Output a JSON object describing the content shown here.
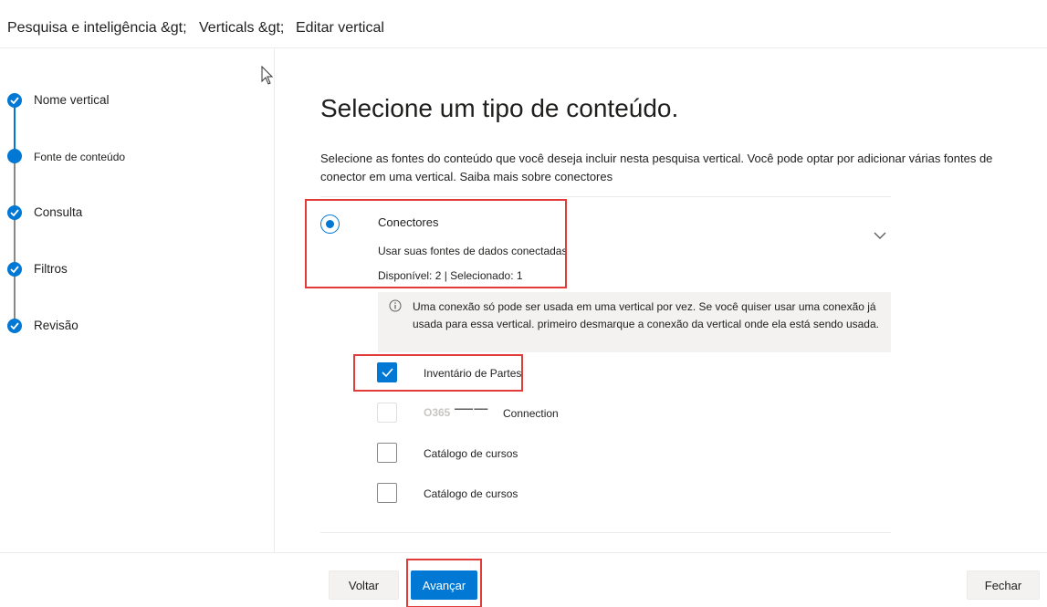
{
  "breadcrumb": {
    "items": [
      "Pesquisa e inteligência &gt;",
      "Verticals &gt;",
      "Editar vertical"
    ]
  },
  "steps": [
    {
      "label": "Nome vertical",
      "state": "completed"
    },
    {
      "label": "Fonte de conteúdo",
      "state": "current"
    },
    {
      "label": "Consulta",
      "state": "completed"
    },
    {
      "label": "Filtros",
      "state": "completed"
    },
    {
      "label": "Revisão",
      "state": "completed"
    }
  ],
  "main": {
    "title": "Selecione um tipo de conteúdo.",
    "description": "Selecione as fontes do conteúdo que você deseja incluir nesta pesquisa vertical. Você pode optar por adicionar várias fontes de conector em uma vertical.",
    "learn_more": "Saiba mais sobre conectores"
  },
  "connectors": {
    "title": "Conectores",
    "subtitle": "Usar suas fontes de dados conectadas",
    "stats": "Disponível: 2 | Selecionado: 1",
    "selected": true,
    "expanded": true,
    "info": "Uma conexão só pode ser usada em uma vertical por vez. Se você quiser usar uma conexão já usada para essa vertical. primeiro desmarque a conexão da vertical onde ela está sendo usada.",
    "items": [
      {
        "label": "Inventário de Partes",
        "checked": true,
        "disabled": false
      },
      {
        "label_prefix": "O365",
        "label": "Connection",
        "checked": false,
        "disabled": true
      },
      {
        "label": "Catálogo de cursos",
        "checked": false,
        "disabled": false
      },
      {
        "label": "Catálogo de cursos",
        "checked": false,
        "disabled": false
      }
    ]
  },
  "footer": {
    "back_label": "Voltar",
    "next_label": "Avançar",
    "close_label": "Fechar"
  },
  "colors": {
    "accent": "#0078d4",
    "highlight": "#e33a3a",
    "info_background": "#f3f2f1"
  }
}
